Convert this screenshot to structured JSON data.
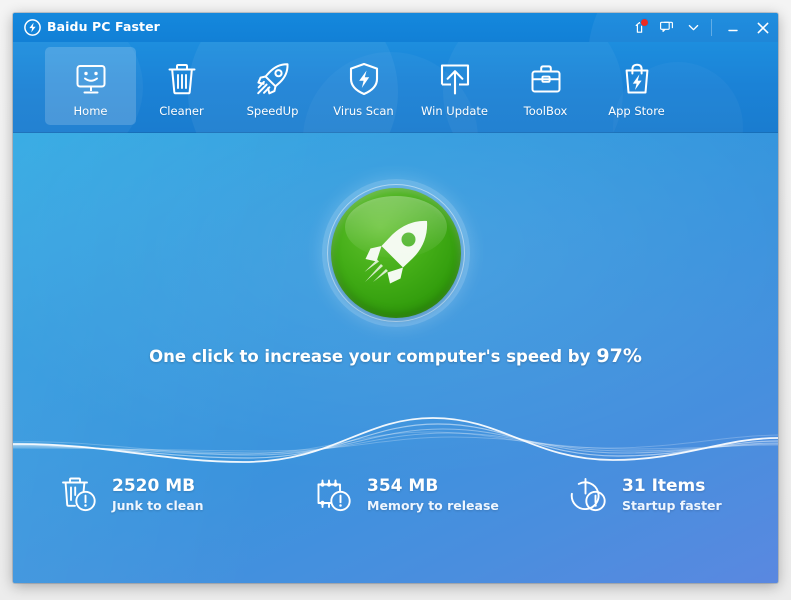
{
  "window": {
    "title": "Baidu PC Faster",
    "logo_icon": "lightning-circle-icon"
  },
  "titlebar": {
    "gift_icon": "gift-icon",
    "gift_badge": "notification-dot",
    "feedback_icon": "message-icon",
    "menu_icon": "chevron-down-icon",
    "minimize_label": "minimize-icon",
    "close_label": "close-icon"
  },
  "nav": {
    "items": [
      {
        "label": "Home",
        "icon": "monitor-smiley-icon",
        "active": true
      },
      {
        "label": "Cleaner",
        "icon": "trash-icon",
        "active": false
      },
      {
        "label": "SpeedUp",
        "icon": "rocket-icon",
        "active": false
      },
      {
        "label": "Virus Scan",
        "icon": "shield-bolt-icon",
        "active": false
      },
      {
        "label": "Win Update",
        "icon": "upload-box-icon",
        "active": false
      },
      {
        "label": "ToolBox",
        "icon": "briefcase-icon",
        "active": false
      },
      {
        "label": "App Store",
        "icon": "shopping-bag-bolt-icon",
        "active": false
      }
    ]
  },
  "main": {
    "action_button": {
      "icon": "rocket-icon",
      "color": "#39a614"
    },
    "tagline_prefix": "One click to increase your computer's speed by",
    "tagline_percent": "97%",
    "stats": [
      {
        "icon": "trash-alert-icon",
        "value": "2520 MB",
        "label": "Junk to clean"
      },
      {
        "icon": "memory-alert-icon",
        "value": "354 MB",
        "label": "Memory to release"
      },
      {
        "icon": "power-alert-icon",
        "value": "31  Items",
        "label": "Startup faster"
      }
    ]
  },
  "colors": {
    "titlebar": "#1488dd",
    "toolbar": "#1b82d6",
    "body_top": "#2ca7e2",
    "body_bottom": "#5a88e0",
    "accent_green": "#39a614",
    "badge_red": "#ee2b22"
  }
}
